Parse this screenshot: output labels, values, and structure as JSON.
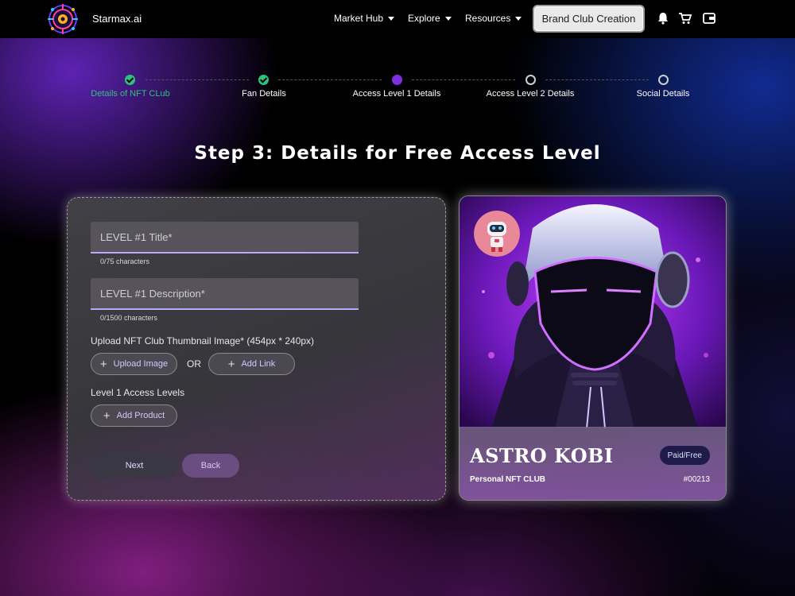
{
  "header": {
    "brand_name": "Starmax.ai",
    "nav": [
      {
        "label": "Market Hub"
      },
      {
        "label": "Explore"
      },
      {
        "label": "Resources"
      }
    ],
    "cta_label": "Brand Club Creation",
    "icons": [
      "bell-icon",
      "cart-icon",
      "wallet-icon"
    ]
  },
  "stepper": {
    "steps": [
      {
        "label": "Details of NFT CLub",
        "state": "done"
      },
      {
        "label": "Fan Details",
        "state": "done"
      },
      {
        "label": "Access Level 1 Details",
        "state": "active"
      },
      {
        "label": "Access Level 2 Details",
        "state": "todo"
      },
      {
        "label": "Social Details",
        "state": "todo"
      }
    ]
  },
  "page_title": "Step 3: Details for Free Access Level",
  "form": {
    "title_field": {
      "placeholder": "LEVEL #1 Title*",
      "value": "",
      "helper": "0/75 characters"
    },
    "description_field": {
      "placeholder": "LEVEL #1 Description*",
      "value": "",
      "helper": "0/1500 characters"
    },
    "upload_label": "Upload NFT Club Thumbnail Image* (454px * 240px)",
    "upload_button": "Upload Image",
    "or_text": "OR",
    "add_link_button": "Add Link",
    "access_levels_label": "Level 1 Access Levels",
    "add_product_button": "Add Product",
    "next_button": "Next",
    "back_button": "Back"
  },
  "preview": {
    "club_name": "ASTRO KOBI",
    "badge": "Paid/Free",
    "subtitle": "Personal NFT CLUB",
    "club_id": "#00213"
  },
  "colors": {
    "done": "#2ec27e",
    "active": "#7b2fe0",
    "accent_underline": "#b8a8ff"
  }
}
